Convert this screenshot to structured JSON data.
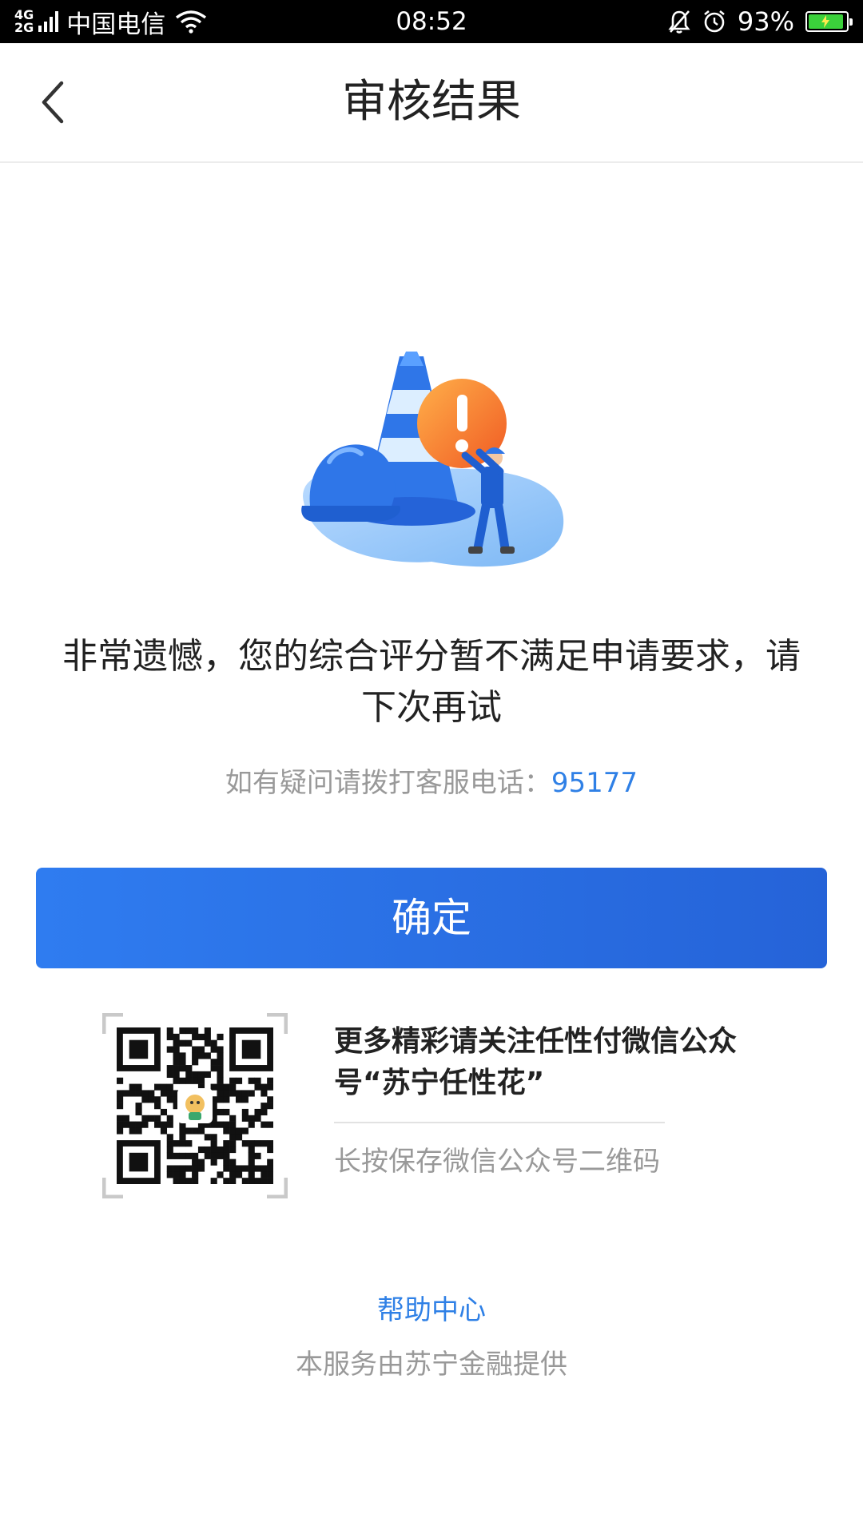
{
  "status_bar": {
    "network_top": "4G",
    "network_bottom": "2G",
    "carrier": "中国电信",
    "time": "08:52",
    "battery": "93%",
    "battery_level": 0.93,
    "icons": [
      "signal-icon",
      "wifi-icon",
      "mute-icon",
      "alarm-icon",
      "battery-icon"
    ]
  },
  "nav": {
    "title": "审核结果",
    "back_icon": "back-arrow-icon"
  },
  "result": {
    "illustration": "warning-traffic-cone-illustration",
    "message": "非常遗憾，您的综合评分暂不满足申请要求，请下次再试",
    "hotline_prefix": "如有疑问请拨打客服电话：",
    "hotline_number": "95177"
  },
  "confirm_button": {
    "label": "确定"
  },
  "wechat": {
    "follow_text": "更多精彩请关注任性付微信公众号“苏宁任性花”",
    "save_hint": "长按保存微信公众号二维码"
  },
  "footer": {
    "help_link": "帮助中心",
    "provider": "本服务由苏宁金融提供"
  },
  "colors": {
    "primary": "#2f7cf0",
    "link": "#2f80e6",
    "muted_text": "#999999",
    "warning_orange": "#f47a2a"
  }
}
